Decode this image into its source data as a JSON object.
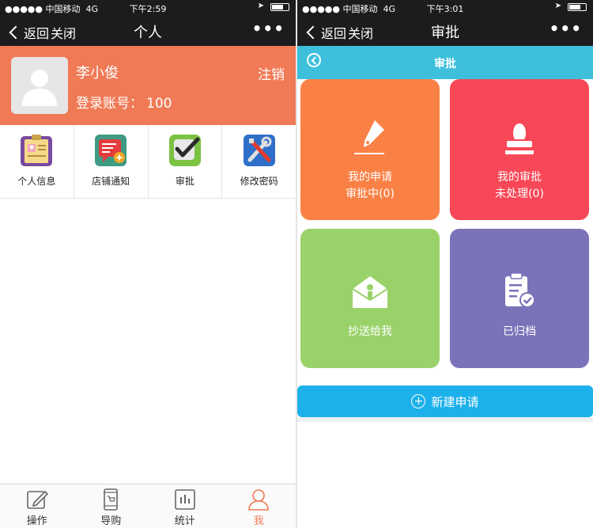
{
  "status_left": {
    "carrier": "●●●●● 中国移动",
    "network": "4G",
    "time": "下午2:59"
  },
  "status_right": {
    "carrier": "●●●●● 中国移动",
    "network": "4G",
    "time": "下午3:01"
  },
  "nav_left": {
    "back": "返回",
    "close": "关闭",
    "title": "个人",
    "more": "•••"
  },
  "nav_right": {
    "back": "返回",
    "close": "关闭",
    "title": "审批",
    "more": "•••"
  },
  "profile": {
    "name": "李小俊",
    "logout": "注销",
    "account_label": "登录账号：",
    "account_value": "100"
  },
  "menu": [
    {
      "label": "个人信息",
      "icon": "id-card-icon"
    },
    {
      "label": "店铺通知",
      "icon": "notice-icon"
    },
    {
      "label": "审批",
      "icon": "check-icon"
    },
    {
      "label": "修改密码",
      "icon": "tools-icon"
    }
  ],
  "tabs": [
    {
      "label": "操作",
      "icon": "edit-icon",
      "active": false
    },
    {
      "label": "导购",
      "icon": "phone-icon",
      "active": false
    },
    {
      "label": "统计",
      "icon": "chart-icon",
      "active": false
    },
    {
      "label": "我",
      "icon": "user-icon",
      "active": true
    }
  ],
  "approval": {
    "subtitle": "审批",
    "tiles": [
      {
        "line1": "我的申请",
        "line2": "审批中(0)",
        "icon": "pen-icon",
        "color": "#fa8146"
      },
      {
        "line1": "我的审批",
        "line2": "未处理(0)",
        "icon": "stamp-icon",
        "color": "#f84756"
      },
      {
        "line1": "抄送给我",
        "line2": "",
        "icon": "mail-icon",
        "color": "#9ad26a"
      },
      {
        "line1": "已归档",
        "line2": "",
        "icon": "clipboard-check-icon",
        "color": "#7b73b9"
      }
    ],
    "new_request": "新建申请"
  },
  "colors": {
    "profile_bg": "#f07a56",
    "subbar_bg": "#3ec0dd",
    "new_button": "#1cb1ea",
    "nav_bg": "#1c1c1e"
  }
}
